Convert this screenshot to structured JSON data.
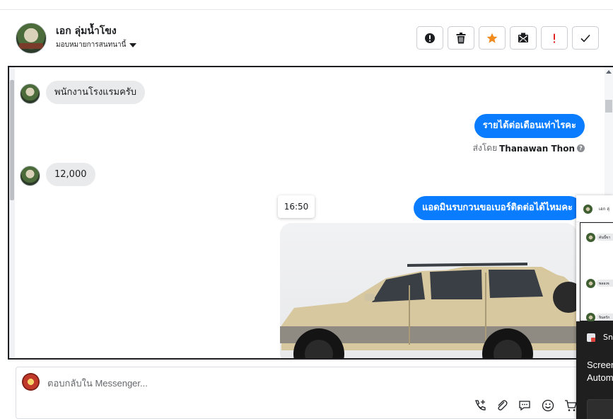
{
  "header": {
    "contact_name": "เอก ลุ่มน้ำโขง",
    "assign_label": "มอบหมายการสนทนานี้"
  },
  "actions": [
    {
      "icon": "alert-circle-icon",
      "label": "!"
    },
    {
      "icon": "trash-icon"
    },
    {
      "icon": "star-icon",
      "color": "#f28a1e"
    },
    {
      "icon": "mail-block-icon"
    },
    {
      "icon": "exclamation-icon",
      "label": "!",
      "color": "#e02424"
    },
    {
      "icon": "check-icon"
    }
  ],
  "messages": {
    "m1": {
      "direction": "incoming",
      "text": "พนักงานโรงแรมครับ"
    },
    "m2": {
      "direction": "outgoing",
      "text": "รายได้ต่อเดือนเท่าไรคะ"
    },
    "sent_by": {
      "prefix": "ส่งโดย",
      "name": "Thanawan Thon",
      "help": "?"
    },
    "m3": {
      "direction": "incoming",
      "text": "12,000"
    },
    "m4": {
      "direction": "outgoing",
      "text": "แอดมินรบกวนขอเบอร์ติดต่อได้ไหมคะ"
    },
    "time_tooltip": "16:50",
    "m5": {
      "direction": "outgoing",
      "type": "image",
      "subject": "car-photo"
    }
  },
  "reply": {
    "placeholder": "ตอบกลับใน Messenger...",
    "tools": [
      "call-add-icon",
      "attachment-icon",
      "saved-reply-icon",
      "emoji-icon",
      "cart-icon"
    ]
  },
  "mini_panel": {
    "contact_name": "เอก ลุ่",
    "messages": [
      "คันนี้ขา",
      "พลองจ",
      "จินตรัก"
    ]
  },
  "notification": {
    "app": "Sn",
    "line1": "Screen",
    "line2": "Autom"
  },
  "colors": {
    "accent_blue": "#0a7cff",
    "incoming_bubble": "#e9eaec",
    "star": "#f28a1e",
    "danger": "#e02424"
  }
}
